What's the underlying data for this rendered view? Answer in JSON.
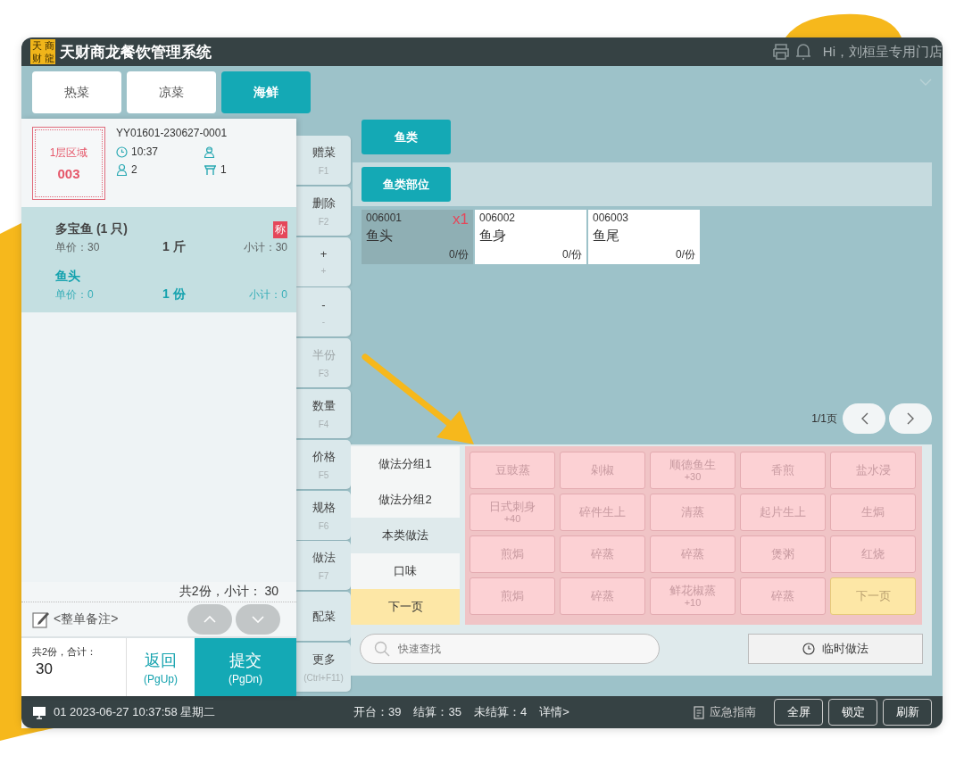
{
  "app": {
    "logo": [
      "天",
      "商",
      "财",
      "龍"
    ],
    "title": "天财商龙餐饮管理系统",
    "greeting": "Hi，刘桓呈专用门店"
  },
  "tabs": [
    {
      "label": "热菜",
      "selected": false
    },
    {
      "label": "凉菜",
      "selected": false
    },
    {
      "label": "海鲜",
      "selected": true
    }
  ],
  "order": {
    "area": "1层区域",
    "table": "003",
    "number": "YY01601-230627-0001",
    "time": "10:37",
    "guests": "2",
    "seats": "1",
    "items": [
      {
        "name": "多宝鱼 (1 只)",
        "badge": "称",
        "unit_price": "单价：30",
        "qty": "1 斤",
        "subtotal": "小计：30",
        "selected": false
      },
      {
        "name": "鱼头",
        "unit_price": "单价：0",
        "qty": "1 份",
        "subtotal": "小计：0",
        "selected": true
      }
    ],
    "summary": "共2份，小计： 30",
    "remark": "<整单备注>",
    "total_label": "共2份，合计：",
    "total": "30",
    "back": {
      "label": "返回",
      "key": "(PgUp)"
    },
    "submit": {
      "label": "提交",
      "key": "(PgDn)"
    }
  },
  "functions": [
    {
      "label": "赠菜",
      "key": "F1",
      "disabled": false
    },
    {
      "label": "删除",
      "key": "F2",
      "disabled": false
    },
    {
      "label": "+",
      "key": "+",
      "disabled": false
    },
    {
      "label": "-",
      "key": "-",
      "disabled": false
    },
    {
      "label": "半份",
      "key": "F3",
      "disabled": true
    },
    {
      "label": "数量",
      "key": "F4",
      "disabled": false
    },
    {
      "label": "价格",
      "key": "F5",
      "disabled": false
    },
    {
      "label": "规格",
      "key": "F6",
      "disabled": false
    },
    {
      "label": "做法",
      "key": "F7",
      "disabled": false
    },
    {
      "label": "配菜",
      "disabled": false
    },
    {
      "label": "更多",
      "key": "(Ctrl+F11)",
      "disabled": false
    }
  ],
  "categories": [
    {
      "label": "鱼类",
      "selected": true
    }
  ],
  "subcategories": [
    {
      "label": "鱼类部位",
      "selected": true
    }
  ],
  "dishes": [
    {
      "code": "006001",
      "name": "鱼头",
      "stock": "0/份",
      "count": "x1",
      "selected": true
    },
    {
      "code": "006002",
      "name": "鱼身",
      "stock": "0/份",
      "selected": false
    },
    {
      "code": "006003",
      "name": "鱼尾",
      "stock": "0/份",
      "selected": false
    }
  ],
  "pager": {
    "label": "1/1页"
  },
  "method_groups": [
    {
      "label": "做法分组1",
      "kind": "group",
      "selected": false
    },
    {
      "label": "做法分组2",
      "kind": "group",
      "selected": false
    },
    {
      "label": "本类做法",
      "kind": "group",
      "selected": true
    },
    {
      "label": "口味",
      "kind": "group",
      "selected": false
    },
    {
      "label": "下一页",
      "kind": "next",
      "selected": false
    }
  ],
  "methods": [
    {
      "name": "豆豉蒸",
      "kind": "method"
    },
    {
      "name": "剁椒",
      "kind": "method"
    },
    {
      "name": "顺德鱼生",
      "price": "+30",
      "kind": "method"
    },
    {
      "name": "香煎",
      "kind": "method"
    },
    {
      "name": "盐水浸",
      "kind": "method"
    },
    {
      "name": "日式刺身",
      "price": "+40",
      "kind": "method"
    },
    {
      "name": "碎件生上",
      "kind": "method"
    },
    {
      "name": "清蒸",
      "kind": "method"
    },
    {
      "name": "起片生上",
      "kind": "method"
    },
    {
      "name": "生焗",
      "kind": "method"
    },
    {
      "name": "煎焗",
      "kind": "method"
    },
    {
      "name": "碎蒸",
      "kind": "method"
    },
    {
      "name": "碎蒸",
      "kind": "method"
    },
    {
      "name": "煲粥",
      "kind": "method"
    },
    {
      "name": "红烧",
      "kind": "method"
    },
    {
      "name": "煎焗",
      "kind": "method"
    },
    {
      "name": "碎蒸",
      "kind": "method"
    },
    {
      "name": "鲜花椒蒸",
      "price": "+10",
      "kind": "method"
    },
    {
      "name": "碎蒸",
      "kind": "method"
    },
    {
      "name": "下一页",
      "kind": "next"
    }
  ],
  "search": {
    "placeholder": "快速查找"
  },
  "temp_method": {
    "label": "临时做法"
  },
  "status_bar": {
    "terminal": "01 2023-06-27 10:37:58 星期二",
    "stats": [
      "开台：39",
      "结算：35",
      "未结算：4"
    ],
    "details": "详情>",
    "guide": "应急指南",
    "buttons": [
      "全屏",
      "锁定",
      "刷新"
    ]
  }
}
